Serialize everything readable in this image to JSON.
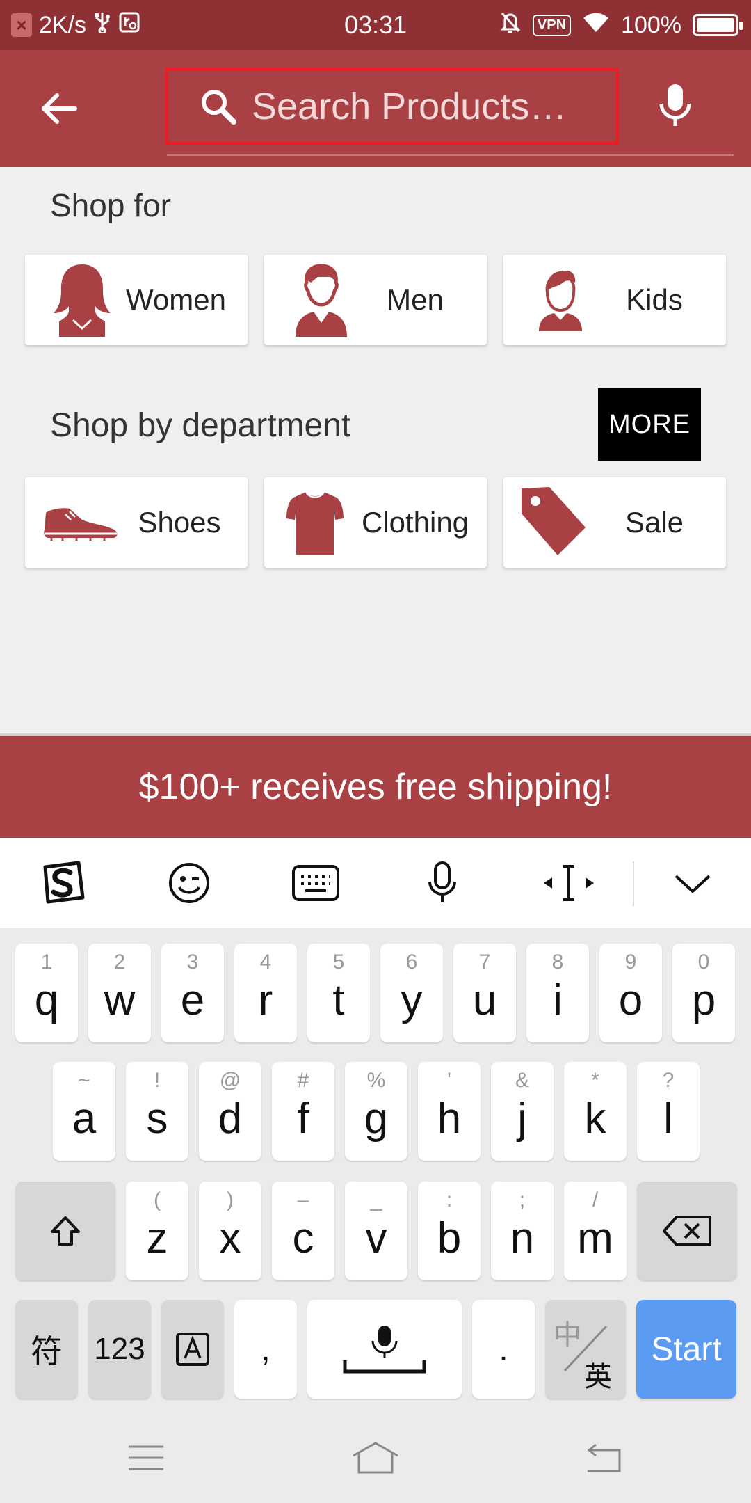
{
  "status_bar": {
    "speed": "2K/s",
    "time": "03:31",
    "vpn": "VPN",
    "battery": "100%"
  },
  "search": {
    "placeholder": "Search Products…"
  },
  "shop_for": {
    "title": "Shop for",
    "items": [
      {
        "label": "Women",
        "icon": "woman-icon"
      },
      {
        "label": "Men",
        "icon": "man-icon"
      },
      {
        "label": "Kids",
        "icon": "kid-icon"
      }
    ]
  },
  "department": {
    "title": "Shop by department",
    "more_label": "MORE",
    "items": [
      {
        "label": "Shoes",
        "icon": "shoe-icon"
      },
      {
        "label": "Clothing",
        "icon": "tshirt-icon"
      },
      {
        "label": "Sale",
        "icon": "tag-icon"
      }
    ]
  },
  "promo": {
    "text": "$100+ receives free shipping!"
  },
  "keyboard": {
    "row1": [
      {
        "sym": "1",
        "ch": "q"
      },
      {
        "sym": "2",
        "ch": "w"
      },
      {
        "sym": "3",
        "ch": "e"
      },
      {
        "sym": "4",
        "ch": "r"
      },
      {
        "sym": "5",
        "ch": "t"
      },
      {
        "sym": "6",
        "ch": "y"
      },
      {
        "sym": "7",
        "ch": "u"
      },
      {
        "sym": "8",
        "ch": "i"
      },
      {
        "sym": "9",
        "ch": "o"
      },
      {
        "sym": "0",
        "ch": "p"
      }
    ],
    "row2": [
      {
        "sym": "~",
        "ch": "a"
      },
      {
        "sym": "!",
        "ch": "s"
      },
      {
        "sym": "@",
        "ch": "d"
      },
      {
        "sym": "#",
        "ch": "f"
      },
      {
        "sym": "%",
        "ch": "g"
      },
      {
        "sym": "'",
        "ch": "h"
      },
      {
        "sym": "&",
        "ch": "j"
      },
      {
        "sym": "*",
        "ch": "k"
      },
      {
        "sym": "?",
        "ch": "l"
      }
    ],
    "row3": [
      {
        "sym": "(",
        "ch": "z"
      },
      {
        "sym": ")",
        "ch": "x"
      },
      {
        "sym": "–",
        "ch": "c"
      },
      {
        "sym": "_",
        "ch": "v"
      },
      {
        "sym": ":",
        "ch": "b"
      },
      {
        "sym": ";",
        "ch": "n"
      },
      {
        "sym": "/",
        "ch": "m"
      }
    ],
    "symbols_key": "符",
    "numbers_key": "123",
    "comma_key": ",",
    "period_key": ".",
    "lang_key_top": "中",
    "lang_key_bottom": "英",
    "start_key": "Start"
  }
}
